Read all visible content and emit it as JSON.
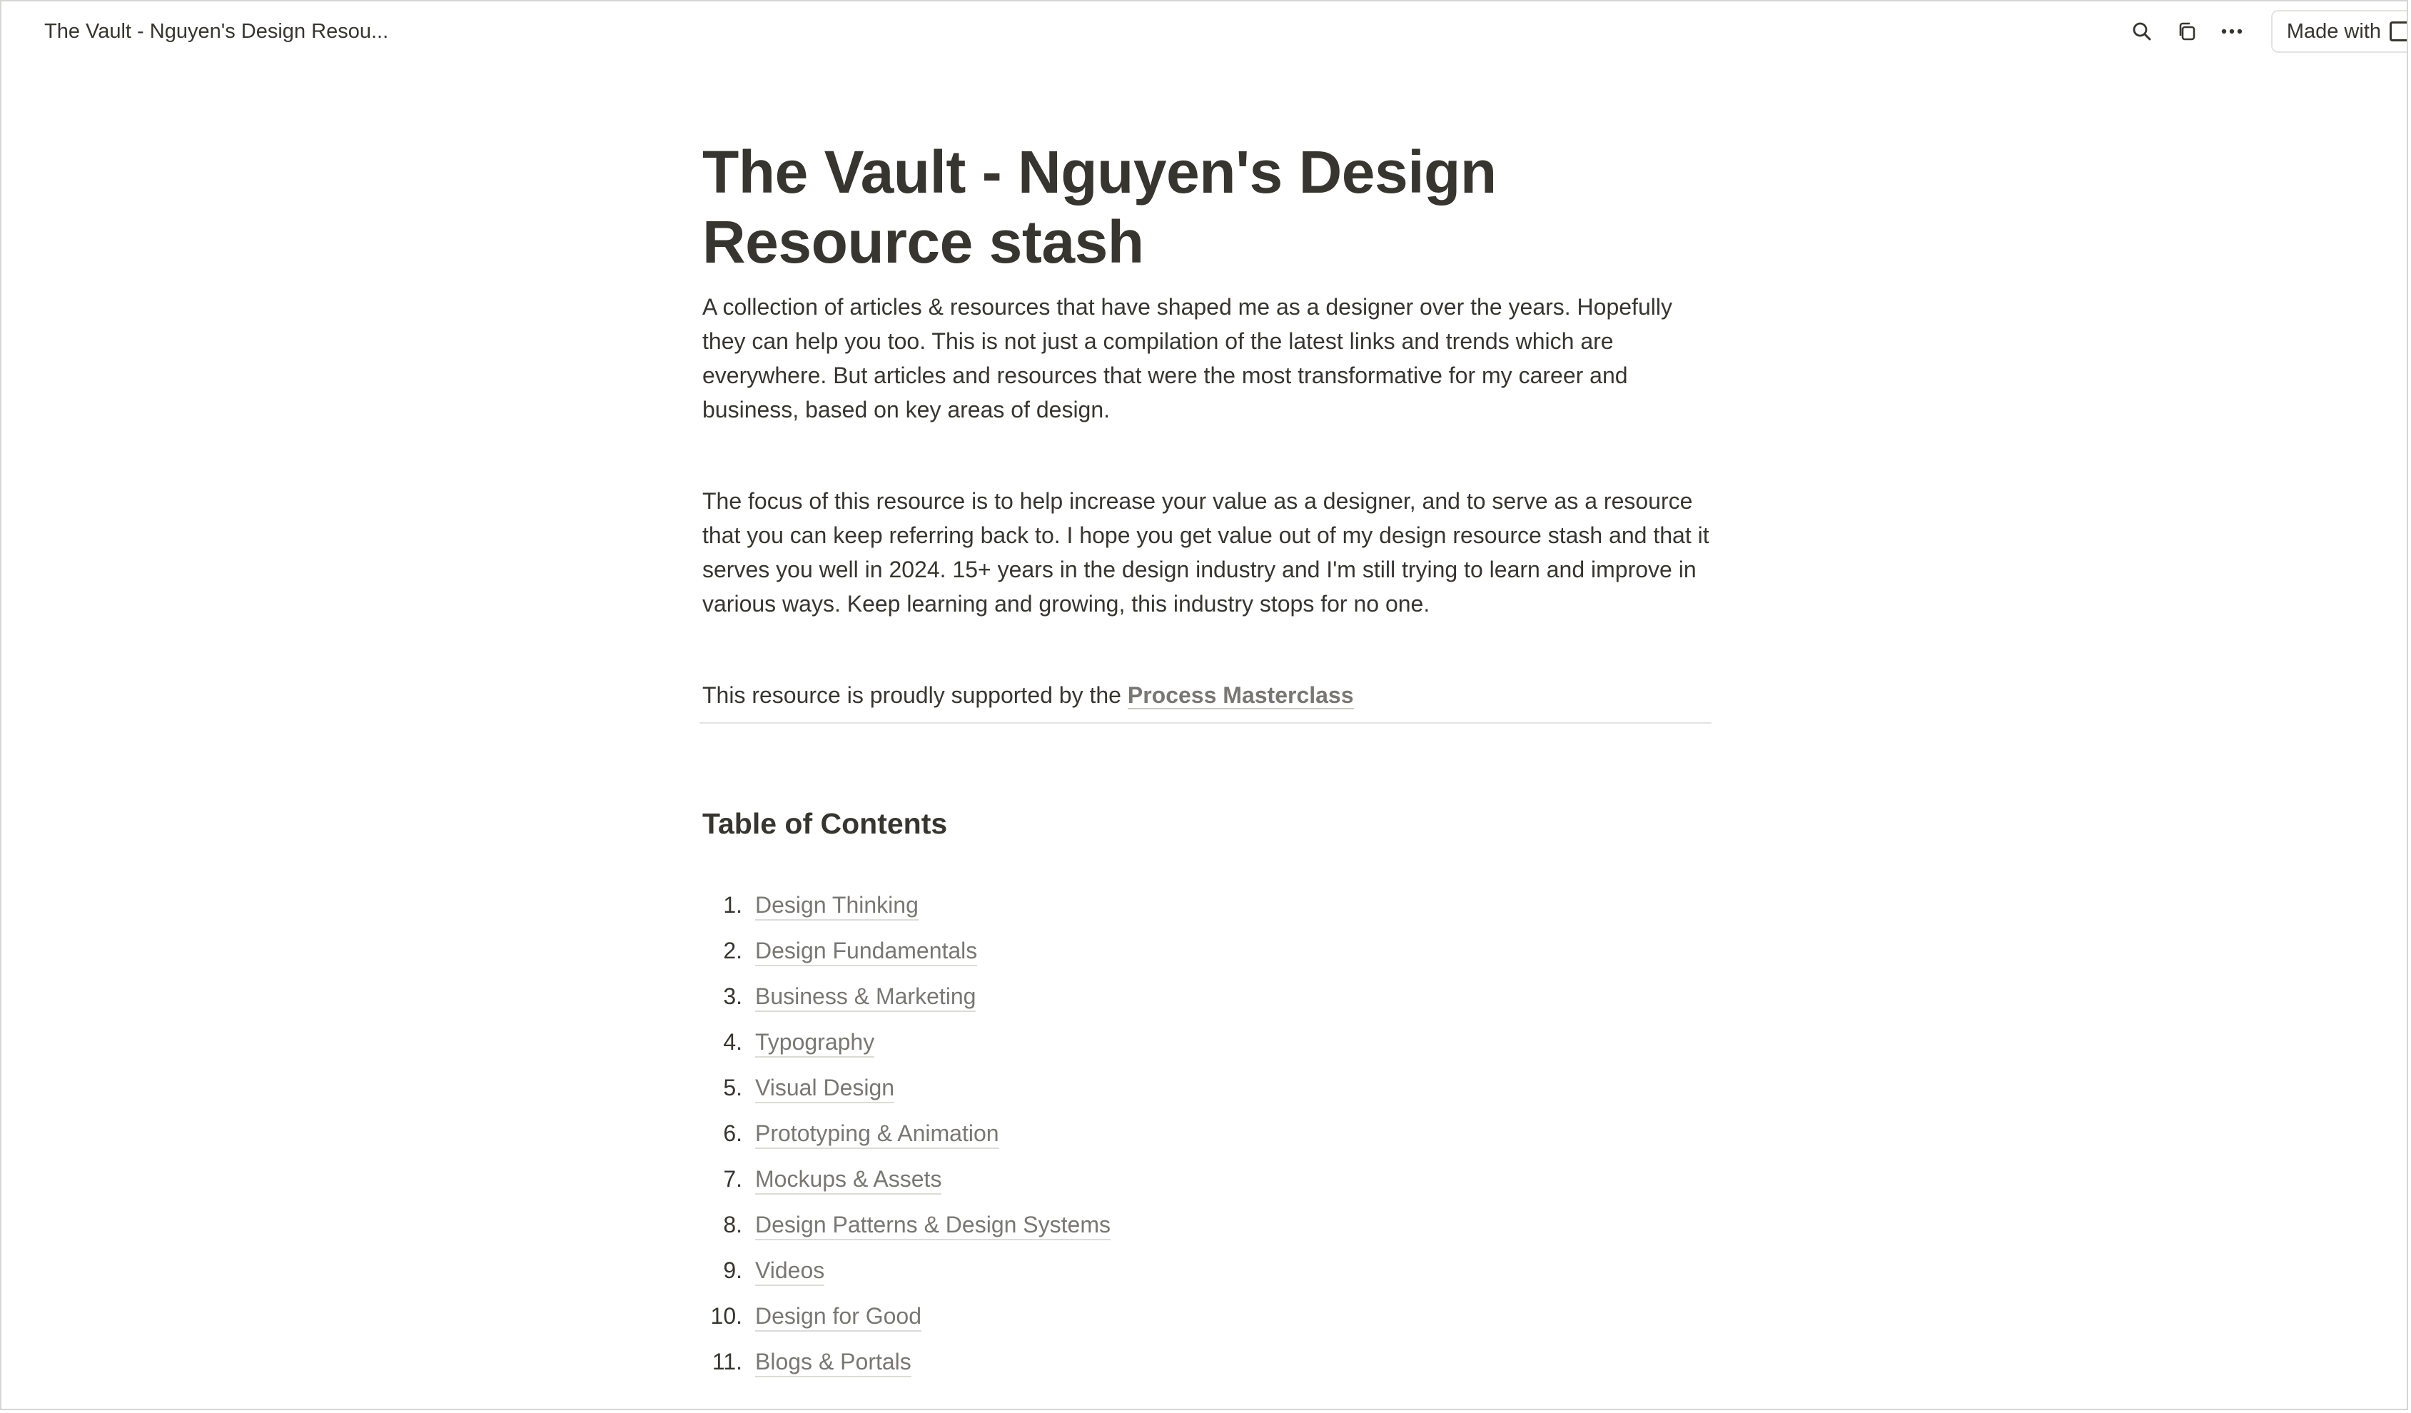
{
  "topbar": {
    "window_title": "The Vault - Nguyen's Design Resou...",
    "made_with_label": "Made with",
    "icons": [
      "search-icon",
      "duplicate-icon",
      "more-icon",
      "notion-logo-icon"
    ]
  },
  "page": {
    "title": "The Vault - Nguyen's Design Resource stash",
    "paragraph_1": "A collection of articles & resources that have shaped me as a designer over the years. Hopefully they can help you too. This is not just a compilation of the latest links and trends which are everywhere. But articles and resources that were the most transformative for my career and business, based on key areas of design.",
    "paragraph_2": "The focus of this resource is to help increase your value as a designer, and to serve as a resource that you can keep referring back to. I hope you get value out of my design resource stash and that it serves you well in 2024. 15+ years in the design industry and I'm still trying to learn and improve in various ways. Keep learning and growing, this industry stops for no one.",
    "support_prefix": "This resource is proudly supported by the ",
    "support_link": "Process Masterclass"
  },
  "toc": {
    "title": "Table of Contents",
    "items": [
      {
        "num": "1.",
        "label": "Design Thinking"
      },
      {
        "num": "2.",
        "label": "Design Fundamentals"
      },
      {
        "num": "3.",
        "label": "Business & Marketing"
      },
      {
        "num": "4.",
        "label": "Typography"
      },
      {
        "num": "5.",
        "label": "Visual Design"
      },
      {
        "num": "6.",
        "label": "Prototyping & Animation"
      },
      {
        "num": "7.",
        "label": "Mockups & Assets"
      },
      {
        "num": "8.",
        "label": "Design Patterns & Design Systems"
      },
      {
        "num": "9.",
        "label": "Videos"
      },
      {
        "num": "10.",
        "label": "Design for Good"
      },
      {
        "num": "11.",
        "label": "Blogs & Portals"
      }
    ]
  },
  "colors": {
    "text": "#37352f",
    "link": "#787774",
    "border": "#e3e3e1"
  }
}
